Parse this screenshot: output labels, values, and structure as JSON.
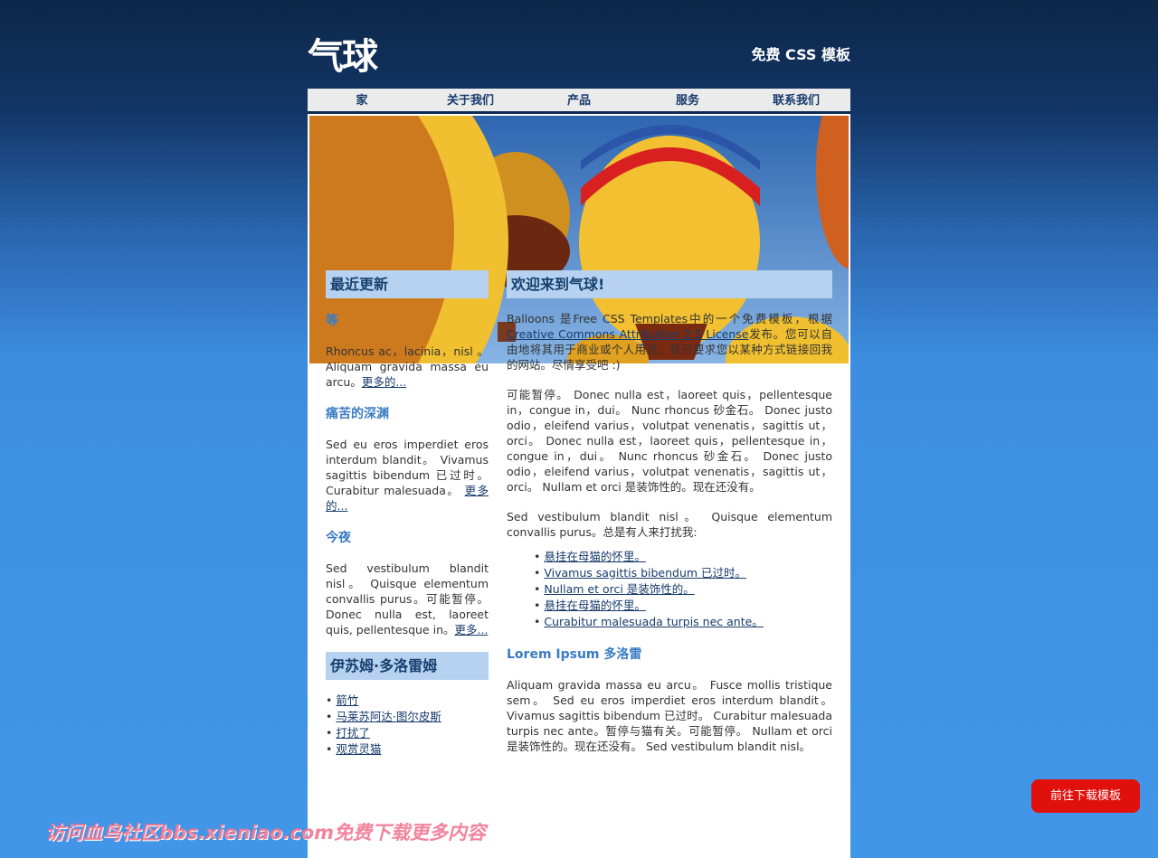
{
  "header": {
    "logo": "气球",
    "slogan": "免费 CSS 模板"
  },
  "nav": [
    "家",
    "关于我们",
    "产品",
    "服务",
    "联系我们"
  ],
  "sidebar": {
    "title": "最近更新",
    "posts": [
      {
        "title": "等",
        "text": "Rhoncus  ac，lacinia，nisl 。 Aliquam gravida massa eu arcu。",
        "more": "更多的..."
      },
      {
        "title": "痛苦的深渊",
        "text": "Sed eu eros imperdiet eros interdum blandit。 Vivamus sagittis bibendum 已过时。 Curabitur malesuada。",
        "more": "更多的..."
      },
      {
        "title": "今夜",
        "text": "Sed vestibulum blandit nisl。 Quisque elementum convallis purus。可能暂停。 Donec nulla est, laoreet quis, pellentesque in。",
        "more": "更多..."
      }
    ],
    "title2": "伊苏姆·多洛雷姆",
    "links": [
      "箭竹",
      "马莱苏阿达·图尔皮斯",
      "打扰了",
      "观赏灵猫"
    ]
  },
  "main": {
    "title": "欢迎来到气球!",
    "intro_a": "Balloons 是Free CSS Templates中的一个免费模板，根据",
    "license": "Creative Commons Attribution 2.5 License",
    "intro_b": "发布。您可以自由地将其用于商业或个人用途。我只要求您以某种方式链接回我的网站。尽情享受吧 :)",
    "p2": "可能暂停。 Donec nulla est，laoreet quis，pellentesque in，congue in，dui。 Nunc rhoncus 砂金石。 Donec justo odio，eleifend varius，volutpat venenatis，sagittis ut，orci。 Donec nulla est，laoreet quis，pellentesque in，congue in，dui。 Nunc rhoncus 砂金石。 Donec justo odio，eleifend varius，volutpat venenatis，sagittis ut，orci。 Nullam et orci 是装饰性的。现在还没有。",
    "p3": "Sed vestibulum blandit nisl。 Quisque elementum convallis purus。总是有人来打扰我:",
    "list": [
      "悬挂在母猫的怀里。",
      "Vivamus sagittis bibendum 已过时。",
      "Nullam et orci 是装饰性的。",
      "悬挂在母猫的怀里。",
      "Curabitur malesuada turpis nec ante。"
    ],
    "subtitle": "Lorem Ipsum 多洛雷",
    "p4": "Aliquam gravida massa eu arcu。 Fusce mollis tristique sem。 Sed eu eros imperdiet eros interdum blandit。 Vivamus sagittis bibendum 已过时。 Curabitur malesuada turpis nec ante。暂停与猫有关。可能暂停。 Nullam et orci 是装饰性的。现在还没有。 Sed vestibulum blandit nisl。"
  },
  "download_button": "前往下载模板",
  "watermark": "访问血鸟社区bbs.xieniao.com免费下载更多内容",
  "colors": {
    "heading_bg": "#b6d2f0",
    "heading_text": "#17406f",
    "subheading": "#3a7cc4",
    "download": "#e0100c"
  }
}
